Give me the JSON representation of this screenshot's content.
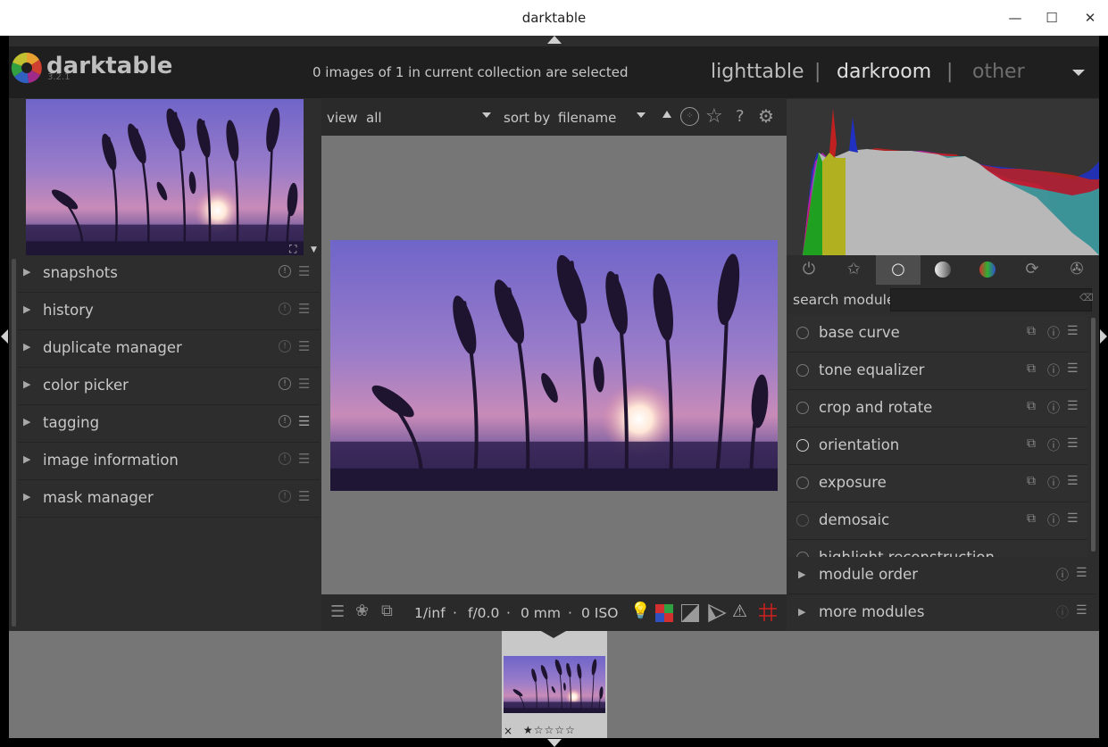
{
  "window": {
    "title": "darktable",
    "minimize": "—",
    "maximize": "☐",
    "close": "✕"
  },
  "header": {
    "app_name": "darktable",
    "version": "3.2.1",
    "selection_status": "0 images of 1 in current collection are selected",
    "views": [
      {
        "label": "lighttable",
        "active": false
      },
      {
        "label": "darkroom",
        "active": true
      },
      {
        "label": "other",
        "active": false
      }
    ],
    "separator": "|"
  },
  "left_panel": {
    "modules": [
      {
        "label": "snapshots",
        "info_active": true
      },
      {
        "label": "history",
        "info_active": false
      },
      {
        "label": "duplicate manager",
        "info_active": false
      },
      {
        "label": "color picker",
        "info_active": true
      },
      {
        "label": "tagging",
        "info_active": true
      },
      {
        "label": "image information",
        "info_active": false
      },
      {
        "label": "mask manager",
        "info_active": false
      }
    ]
  },
  "center_toolbar": {
    "view_label": "view",
    "view_value": "all",
    "sort_label": "sort by",
    "sort_value": "filename"
  },
  "bottom_toolbar": {
    "exposure": "1/inf",
    "aperture": "f/0.0",
    "focal": "0 mm",
    "iso": "0 ISO",
    "dot": "·"
  },
  "right_panel": {
    "search_label": "search module",
    "search_value": "",
    "modules": [
      {
        "label": "base curve",
        "enabled": false
      },
      {
        "label": "tone equalizer",
        "enabled": false
      },
      {
        "label": "crop and rotate",
        "enabled": false
      },
      {
        "label": "orientation",
        "enabled": true
      },
      {
        "label": "exposure",
        "enabled": false
      },
      {
        "label": "demosaic",
        "enabled": false
      }
    ],
    "partial_module": "highlight reconstruction",
    "footer": [
      {
        "label": "module order"
      },
      {
        "label": "more modules"
      }
    ]
  },
  "filmstrip": {
    "reject": "×",
    "stars": "★☆☆☆☆"
  },
  "colors": {
    "sky_top": "#7b6fd0",
    "sky_mid": "#9c7cc8",
    "horizon": "#d98aa8",
    "ground": "#2a1d45"
  }
}
